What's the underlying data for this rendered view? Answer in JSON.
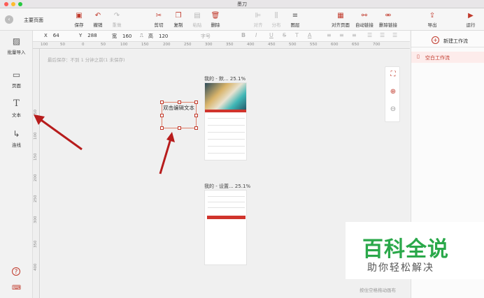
{
  "window": {
    "title": "墨刀",
    "traffic_lights": [
      "#fd5c56",
      "#fdbb2e",
      "#27c840"
    ]
  },
  "toolbar": {
    "home_label": "主要页面",
    "buttons": [
      {
        "label": "保存",
        "icon": "save-icon",
        "glyph": "▣",
        "state": "active"
      },
      {
        "label": "撤销",
        "icon": "undo-icon",
        "glyph": "↶",
        "state": "active"
      },
      {
        "label": "重做",
        "icon": "redo-icon",
        "glyph": "↷",
        "state": "disabled"
      },
      {
        "label": "剪切",
        "icon": "scissors-icon",
        "glyph": "✂",
        "state": "active"
      },
      {
        "label": "复制",
        "icon": "copy-icon",
        "glyph": "❐",
        "state": "active"
      },
      {
        "label": "粘贴",
        "icon": "paste-icon",
        "glyph": "▤",
        "state": "disabled"
      },
      {
        "label": "删除",
        "icon": "trash-icon",
        "glyph": "🗑",
        "state": "active"
      },
      {
        "label": "对齐",
        "icon": "align-icon",
        "glyph": "⊫",
        "state": "disabled"
      },
      {
        "label": "分布",
        "icon": "distribute-icon",
        "glyph": "⫼",
        "state": "disabled"
      },
      {
        "label": "图层",
        "icon": "layers-icon",
        "glyph": "≡",
        "state": "dark"
      },
      {
        "label": "对齐页面",
        "icon": "align-page-icon",
        "glyph": "▦",
        "state": "active"
      },
      {
        "label": "自动链接",
        "icon": "auto-link-icon",
        "glyph": "⚯",
        "state": "active"
      },
      {
        "label": "删除链接",
        "icon": "unlink-icon",
        "glyph": "⚮",
        "state": "active"
      },
      {
        "label": "导出",
        "icon": "export-icon",
        "glyph": "⇪",
        "state": "active"
      },
      {
        "label": "运行",
        "icon": "play-icon",
        "glyph": "▶",
        "state": "active"
      }
    ]
  },
  "left_rail": [
    {
      "label": "批量导入",
      "icon": "image-import-icon",
      "glyph": "▨"
    },
    {
      "label": "页面",
      "icon": "page-icon",
      "glyph": "▭"
    },
    {
      "label": "文本",
      "icon": "text-icon",
      "glyph": "T"
    },
    {
      "label": "连线",
      "icon": "connector-icon",
      "glyph": "↳"
    }
  ],
  "left_rail_bottom": [
    {
      "icon": "help-icon",
      "glyph": "?"
    },
    {
      "icon": "keyboard-icon",
      "glyph": "⌨"
    }
  ],
  "props": {
    "x_label": "X",
    "x_value": "64",
    "y_label": "Y",
    "y_value": "288",
    "w_label": "宽",
    "w_value": "160",
    "h_label": "高",
    "h_value": "120",
    "font_size_placeholder": "字号",
    "lock_icon": "lock-icon",
    "format_buttons": [
      "B",
      "I",
      "U",
      "S",
      "T",
      "A",
      "≡",
      "≡",
      "≡",
      "☰",
      "☰",
      "☰"
    ]
  },
  "ruler": {
    "top": [
      "100",
      "50",
      "0",
      "50",
      "100",
      "150",
      "200",
      "250",
      "300",
      "350",
      "400",
      "450",
      "500",
      "550",
      "600",
      "650",
      "700"
    ],
    "left": [
      "50",
      "100",
      "150",
      "200",
      "250",
      "300",
      "350",
      "400"
    ]
  },
  "canvas": {
    "save_info": "最后保存：不到 1 分钟之前(1 未保存)",
    "textbox_text": "双击编辑文本",
    "page1_title": "我的 - 默... 25.1%",
    "page2_title": "我的 - 设置... 25.1%",
    "hint": "按住空格拖动画布"
  },
  "zoom": {
    "fit_icon": "fit-screen-icon",
    "zoom_in_icon": "zoom-in-icon",
    "zoom_out_icon": "zoom-out-icon"
  },
  "right_panel": {
    "new_flow_label": "新建工作流",
    "flow_item_label": "空白工作流"
  },
  "watermark": {
    "main": "百科全说",
    "sub": "助你轻松解决"
  },
  "colors": {
    "accent": "#c0392b",
    "arrow": "#b71c1c",
    "watermark_green": "#2aa84a"
  }
}
